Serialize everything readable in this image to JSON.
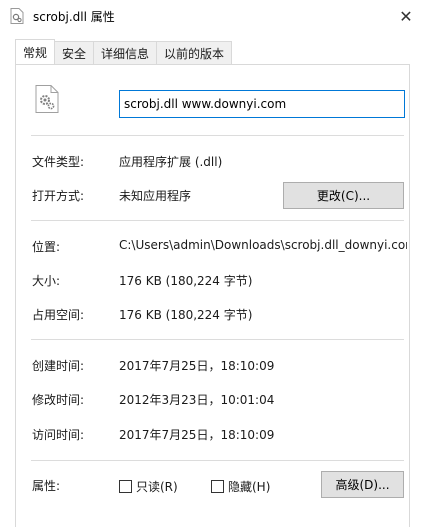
{
  "window": {
    "title": "scrobj.dll 属性",
    "close_glyph": "✕"
  },
  "tabs": [
    {
      "label": "常规"
    },
    {
      "label": "安全"
    },
    {
      "label": "详细信息"
    },
    {
      "label": "以前的版本"
    }
  ],
  "file": {
    "name_value": "scrobj.dll www.downyi.com"
  },
  "props": {
    "type_label": "文件类型:",
    "type_value": "应用程序扩展 (.dll)",
    "open_label": "打开方式:",
    "open_value": "未知应用程序",
    "change_button": "更改(C)...",
    "location_label": "位置:",
    "location_value": "C:\\Users\\admin\\Downloads\\scrobj.dll_downyi.cor",
    "size_label": "大小:",
    "size_value": "176 KB (180,224 字节)",
    "disk_label": "占用空间:",
    "disk_value": "176 KB (180,224 字节)",
    "created_label": "创建时间:",
    "created_value": "2017年7月25日，18:10:09",
    "modified_label": "修改时间:",
    "modified_value": "2012年3月23日，10:01:04",
    "accessed_label": "访问时间:",
    "accessed_value": "2017年7月25日，18:10:09",
    "attr_label": "属性:",
    "readonly_label": "只读(R)",
    "hidden_label": "隐藏(H)",
    "advanced_button": "高级(D)..."
  },
  "icons": {
    "title": "dll-file-icon",
    "file": "dll-gear-file-icon",
    "close": "close-icon"
  },
  "colors": {
    "input_border": "#0078d7",
    "button_bg": "#e1e1e1",
    "separator": "#dcdcdc"
  }
}
